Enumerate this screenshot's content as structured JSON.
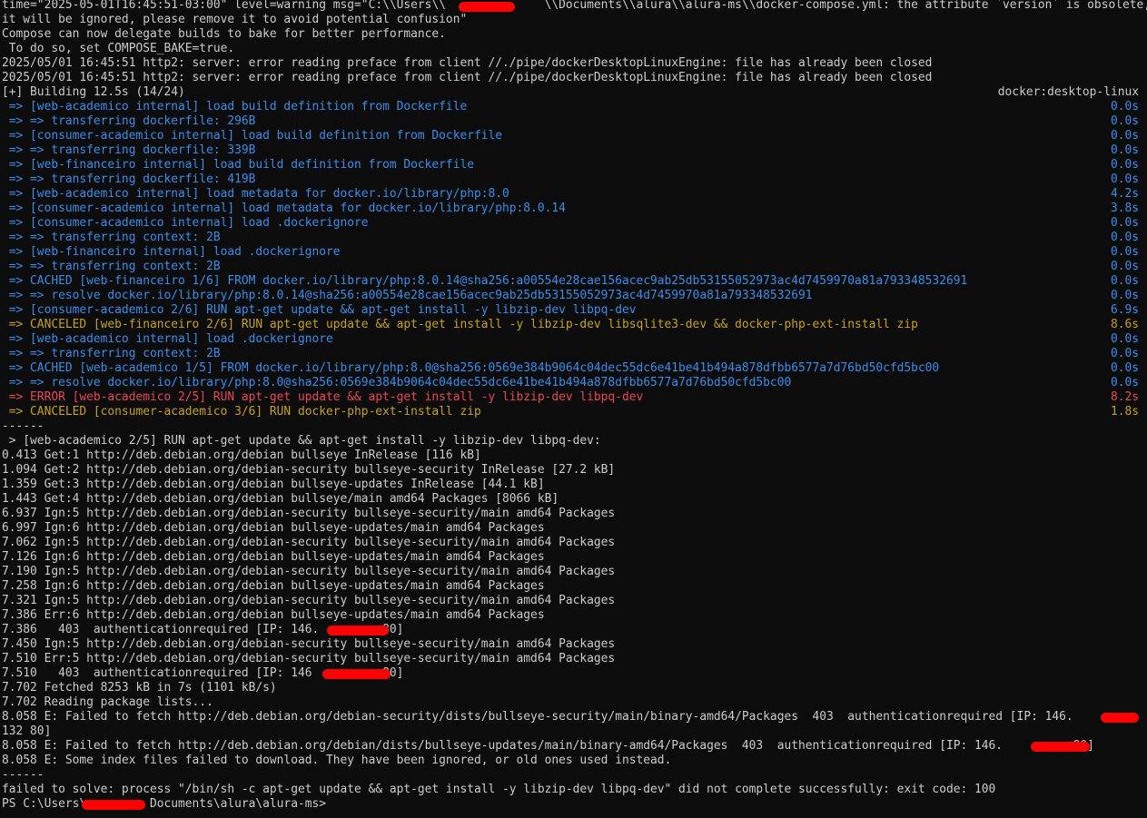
{
  "terminal": {
    "pre_lines": [
      {
        "text": "time=\"2025-05-01T16:45:51-03:00\" level=warning msg=\"C:\\\\Users\\\\              \\\\Documents\\\\alura\\\\alura-ms\\\\docker-compose.yml: the attribute `version` is obsolete,"
      },
      {
        "text": "it will be ignored, please remove it to avoid potential confusion\""
      },
      {
        "text": "Compose can now delegate builds to bake for better performance."
      },
      {
        "text": " To do so, set COMPOSE_BAKE=true."
      },
      {
        "text": "2025/05/01 16:45:51 http2: server: error reading preface from client //./pipe/dockerDesktopLinuxEngine: file has already been closed"
      },
      {
        "text": "2025/05/01 16:45:51 http2: server: error reading preface from client //./pipe/dockerDesktopLinuxEngine: file has already been closed"
      }
    ],
    "build_header": {
      "left": "[+] Building 12.5s (14/24)",
      "right": "docker:desktop-linux"
    },
    "build_steps": [
      {
        "text": " => [web-academico internal] load build definition from Dockerfile",
        "time": "0.0s",
        "color": "blue"
      },
      {
        "text": " => => transferring dockerfile: 296B",
        "time": "0.0s",
        "color": "blue"
      },
      {
        "text": " => [consumer-academico internal] load build definition from Dockerfile",
        "time": "0.0s",
        "color": "blue"
      },
      {
        "text": " => => transferring dockerfile: 339B",
        "time": "0.0s",
        "color": "blue"
      },
      {
        "text": " => [web-financeiro internal] load build definition from Dockerfile",
        "time": "0.0s",
        "color": "blue"
      },
      {
        "text": " => => transferring dockerfile: 419B",
        "time": "0.0s",
        "color": "blue"
      },
      {
        "text": " => [web-academico internal] load metadata for docker.io/library/php:8.0",
        "time": "4.2s",
        "color": "blue"
      },
      {
        "text": " => [consumer-academico internal] load metadata for docker.io/library/php:8.0.14",
        "time": "3.8s",
        "color": "blue"
      },
      {
        "text": " => [consumer-academico internal] load .dockerignore",
        "time": "0.0s",
        "color": "blue"
      },
      {
        "text": " => => transferring context: 2B",
        "time": "0.0s",
        "color": "blue"
      },
      {
        "text": " => [web-financeiro internal] load .dockerignore",
        "time": "0.0s",
        "color": "blue"
      },
      {
        "text": " => => transferring context: 2B",
        "time": "0.0s",
        "color": "blue"
      },
      {
        "text": " => CACHED [web-financeiro 1/6] FROM docker.io/library/php:8.0.14@sha256:a00554e28cae156acec9ab25db53155052973ac4d7459970a81a793348532691",
        "time": "0.0s",
        "color": "blue"
      },
      {
        "text": " => => resolve docker.io/library/php:8.0.14@sha256:a00554e28cae156acec9ab25db53155052973ac4d7459970a81a793348532691",
        "time": "0.0s",
        "color": "blue"
      },
      {
        "text": " => [consumer-academico 2/6] RUN apt-get update && apt-get install -y libzip-dev libpq-dev",
        "time": "6.9s",
        "color": "blue"
      },
      {
        "text": " => CANCELED [web-financeiro 2/6] RUN apt-get update && apt-get install -y libzip-dev libsqlite3-dev && docker-php-ext-install zip",
        "time": "8.6s",
        "color": "yellow"
      },
      {
        "text": " => [web-academico internal] load .dockerignore",
        "time": "0.0s",
        "color": "blue"
      },
      {
        "text": " => => transferring context: 2B",
        "time": "0.0s",
        "color": "blue"
      },
      {
        "text": " => CACHED [web-academico 1/5] FROM docker.io/library/php:8.0@sha256:0569e384b9064c04dec55dc6e41be41b494a878dfbb6577a7d76bd50cfd5bc00",
        "time": "0.0s",
        "color": "blue"
      },
      {
        "text": " => => resolve docker.io/library/php:8.0@sha256:0569e384b9064c04dec55dc6e41be41b494a878dfbb6577a7d76bd50cfd5bc00",
        "time": "0.0s",
        "color": "blue"
      },
      {
        "text": " => ERROR [web-academico 2/5] RUN apt-get update && apt-get install -y libzip-dev libpq-dev",
        "time": "8.2s",
        "color": "red"
      },
      {
        "text": " => CANCELED [consumer-academico 3/6] RUN docker-php-ext-install zip",
        "time": "1.8s",
        "color": "yellow"
      }
    ],
    "post_lines": [
      {
        "text": "------"
      },
      {
        "text": " > [web-academico 2/5] RUN apt-get update && apt-get install -y libzip-dev libpq-dev:"
      },
      {
        "text": "0.413 Get:1 http://deb.debian.org/debian bullseye InRelease [116 kB]"
      },
      {
        "text": "1.094 Get:2 http://deb.debian.org/debian-security bullseye-security InRelease [27.2 kB]"
      },
      {
        "text": "1.359 Get:3 http://deb.debian.org/debian bullseye-updates InRelease [44.1 kB]"
      },
      {
        "text": "1.443 Get:4 http://deb.debian.org/debian bullseye/main amd64 Packages [8066 kB]"
      },
      {
        "text": "6.937 Ign:5 http://deb.debian.org/debian-security bullseye-security/main amd64 Packages"
      },
      {
        "text": "6.997 Ign:6 http://deb.debian.org/debian bullseye-updates/main amd64 Packages"
      },
      {
        "text": "7.062 Ign:5 http://deb.debian.org/debian-security bullseye-security/main amd64 Packages"
      },
      {
        "text": "7.126 Ign:6 http://deb.debian.org/debian bullseye-updates/main amd64 Packages"
      },
      {
        "text": "7.190 Ign:5 http://deb.debian.org/debian-security bullseye-security/main amd64 Packages"
      },
      {
        "text": "7.258 Ign:6 http://deb.debian.org/debian bullseye-updates/main amd64 Packages"
      },
      {
        "text": "7.321 Ign:5 http://deb.debian.org/debian-security bullseye-security/main amd64 Packages"
      },
      {
        "text": "7.386 Err:6 http://deb.debian.org/debian bullseye-updates/main amd64 Packages"
      },
      {
        "text": "7.386   403  authenticationrequired [IP: 146.         80]"
      },
      {
        "text": "7.450 Ign:5 http://deb.debian.org/debian-security bullseye-security/main amd64 Packages"
      },
      {
        "text": "7.510 Err:5 http://deb.debian.org/debian-security bullseye-security/main amd64 Packages"
      },
      {
        "text": "7.510   403  authenticationrequired [IP: 146          80]"
      },
      {
        "text": "7.702 Fetched 8253 kB in 7s (1101 kB/s)"
      },
      {
        "text": "7.702 Reading package lists..."
      },
      {
        "text": "8.058 E: Failed to fetch http://deb.debian.org/debian-security/dists/bullseye-security/main/binary-amd64/Packages  403  authenticationrequired [IP: 146."
      },
      {
        "text": "132 80]"
      },
      {
        "text": "8.058 E: Failed to fetch http://deb.debian.org/debian/dists/bullseye-updates/main/binary-amd64/Packages  403  authenticationrequired [IP: 146.          80]"
      },
      {
        "text": "8.058 E: Some index files failed to download. They have been ignored, or old ones used instead."
      },
      {
        "text": "------"
      },
      {
        "text": "failed to solve: process \"/bin/sh -c apt-get update && apt-get install -y libzip-dev libpq-dev\" did not complete successfully: exit code: 100"
      },
      {
        "text": "PS C:\\Users\\         Documents\\alura\\alura-ms>"
      }
    ]
  },
  "colors": {
    "background": "#0c0c0c",
    "default_text": "#cccccc",
    "blue": "#3b8eea",
    "yellow": "#c7a21f",
    "red": "#e74856",
    "redaction": "#ff0000"
  }
}
